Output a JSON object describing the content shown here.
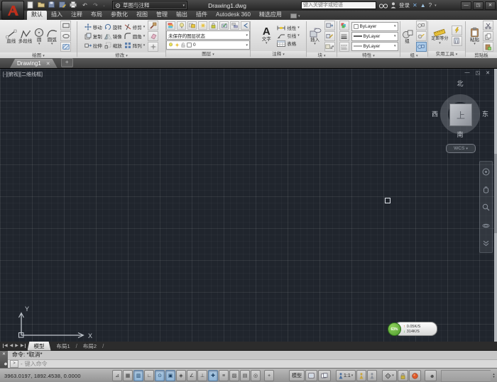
{
  "icons": {
    "dropdown": "▾",
    "close": "✕",
    "minimize": "—",
    "restore": "◳",
    "undo": "↶",
    "redo": "↷",
    "plus": "+",
    "help": "?",
    "exchange": "✕",
    "a360": "▲",
    "prompt": ">",
    "dash": "-",
    "up": "↑",
    "down": "↓",
    "spin_up": "▴",
    "spin_down": "▾",
    "tab_prev": "◀",
    "tab_next": "▶",
    "toggle_glyphs": [
      "⊿",
      "▦",
      "▥",
      "∟",
      "⊙",
      "▣",
      "◈",
      "∠",
      "⊥",
      "✚",
      "≡",
      "▨",
      "▤",
      "◎"
    ]
  },
  "titlebar": {
    "workspace": "草图与注释",
    "doc_title": "Drawing1.dwg",
    "search_placeholder": "键入关键字或短语",
    "signin": "登录"
  },
  "ribbon": {
    "tabs": [
      {
        "label": "默认"
      },
      {
        "label": "插入"
      },
      {
        "label": "注释"
      },
      {
        "label": "布局"
      },
      {
        "label": "参数化"
      },
      {
        "label": "视图"
      },
      {
        "label": "管理"
      },
      {
        "label": "输出"
      },
      {
        "label": "插件"
      },
      {
        "label": "Autodesk 360"
      },
      {
        "label": "精选应用"
      }
    ],
    "panels": {
      "draw": {
        "label": "绘图",
        "tools": [
          "直线",
          "多段线",
          "圆",
          "圆弧"
        ]
      },
      "modify": {
        "label": "修改",
        "tools": [
          "移动",
          "旋转",
          "修剪",
          "复制",
          "镜像",
          "圆角",
          "拉伸",
          "缩放",
          "阵列"
        ]
      },
      "layers": {
        "label": "图层",
        "state": "未保存的图层状态",
        "current": "0"
      },
      "annotation": {
        "label": "注释",
        "text": "文字",
        "tools": [
          "线性",
          "引线",
          "表格"
        ]
      },
      "block": {
        "label": "块",
        "insert": "插入"
      },
      "properties": {
        "label": "特性",
        "color": "ByLayer",
        "lineweight": "ByLayer",
        "linetype": "ByLayer"
      },
      "group": {
        "label": "组",
        "tool": "组"
      },
      "utilities": {
        "label": "实用工具",
        "tool": "定距等分"
      },
      "clipboard": {
        "label": "剪贴板",
        "tool": "粘贴"
      }
    }
  },
  "filetab": {
    "name": "Drawing1"
  },
  "canvas": {
    "viewport_label": "[-][俯视][二维线框]",
    "viewcube": {
      "north": "北",
      "south": "南",
      "west": "西",
      "east": "东",
      "top": "上",
      "wcs": "WCS"
    },
    "ucs": {
      "x": "X",
      "y": "Y"
    },
    "badge": {
      "percent": "63%",
      "up": "0.05K/S",
      "down": "314K/S"
    }
  },
  "layout_tabs": {
    "items": [
      "模型",
      "布局1",
      "布局2"
    ]
  },
  "command": {
    "history": "命令: *取消*",
    "prompt_text": "键入命令"
  },
  "statusbar": {
    "coords": "3963.0197, 1892.4538, 0.0000",
    "model": "模型",
    "scale": "1:1"
  }
}
